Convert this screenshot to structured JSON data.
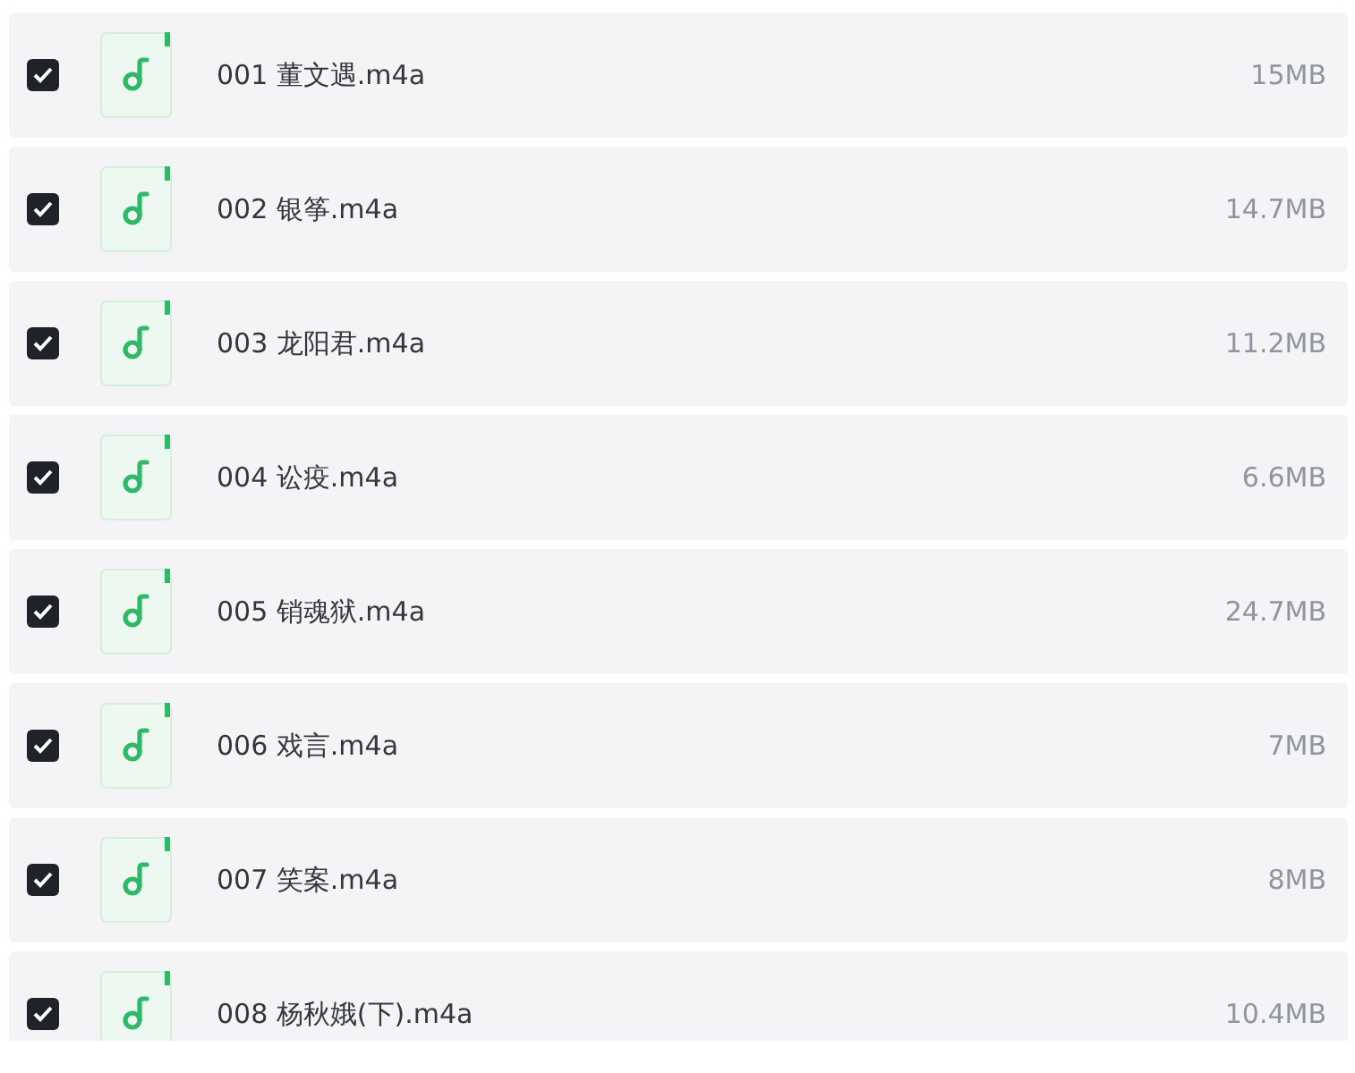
{
  "files": [
    {
      "name": "001 董文遇.m4a",
      "size": "15MB",
      "checked": true
    },
    {
      "name": "002 银筝.m4a",
      "size": "14.7MB",
      "checked": true
    },
    {
      "name": "003 龙阳君.m4a",
      "size": "11.2MB",
      "checked": true
    },
    {
      "name": "004 讼疫.m4a",
      "size": "6.6MB",
      "checked": true
    },
    {
      "name": "005 销魂狱.m4a",
      "size": "24.7MB",
      "checked": true
    },
    {
      "name": "006 戏言.m4a",
      "size": "7MB",
      "checked": true
    },
    {
      "name": "007 笑案.m4a",
      "size": "8MB",
      "checked": true
    },
    {
      "name": "008 杨秋娥(下).m4a",
      "size": "10.4MB",
      "checked": true
    }
  ]
}
